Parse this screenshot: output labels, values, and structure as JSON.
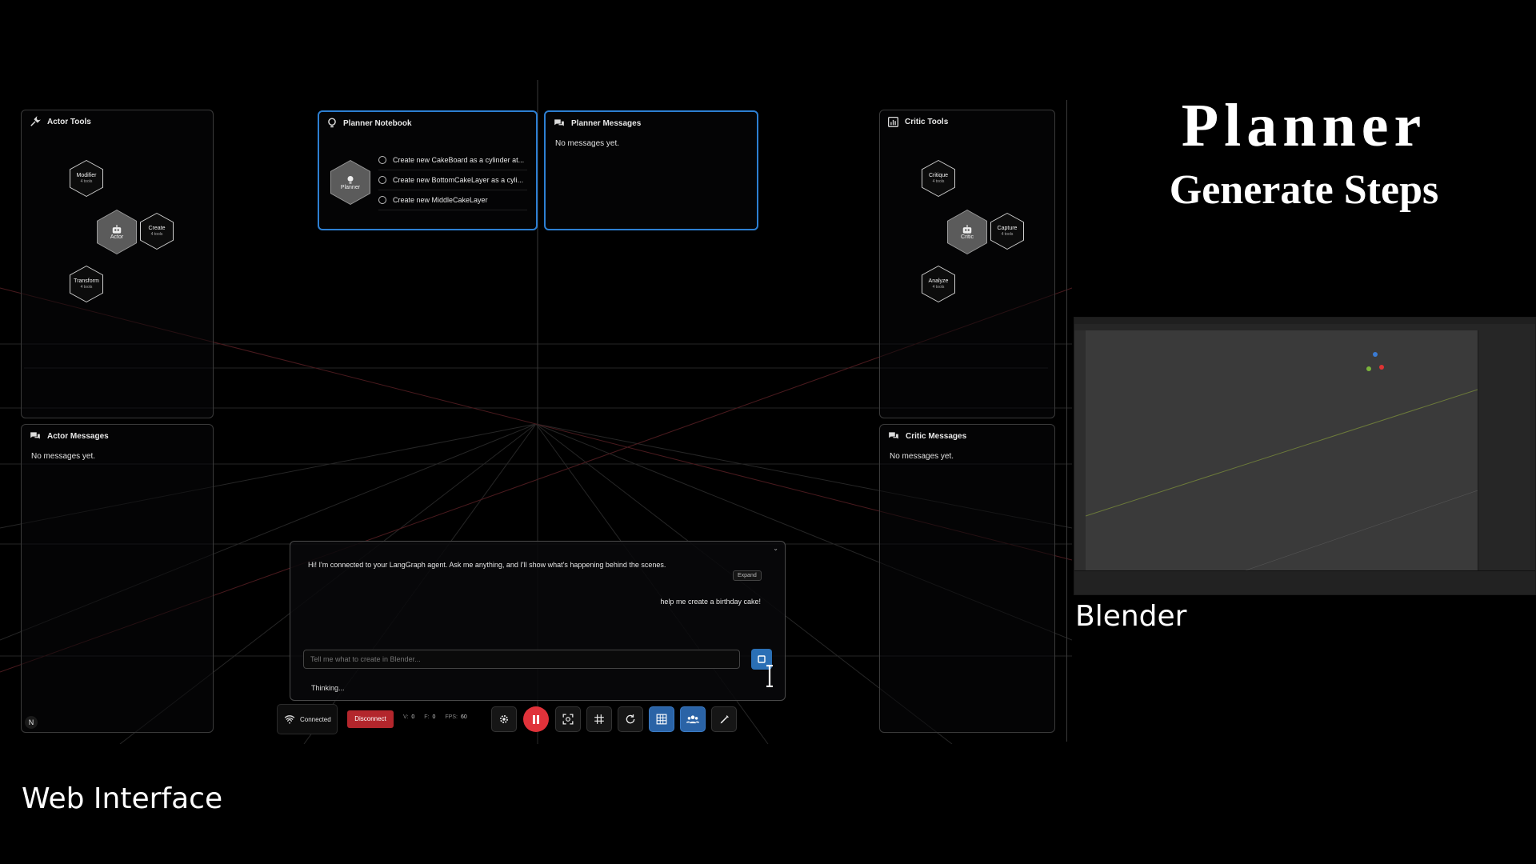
{
  "overlay": {
    "title": "Planner",
    "subtitle": "Generate Steps",
    "web_caption": "Web Interface",
    "blender_caption": "Blender"
  },
  "actor_tools": {
    "title": "Actor Tools",
    "center": "Actor",
    "nodes": [
      {
        "label": "Modifier",
        "sub": "4 tools"
      },
      {
        "label": "Create",
        "sub": "4 tools"
      },
      {
        "label": "Transform",
        "sub": "4 tools"
      }
    ]
  },
  "actor_messages": {
    "title": "Actor Messages",
    "empty": "No messages yet."
  },
  "planner_notebook": {
    "title": "Planner Notebook",
    "center": "Planner",
    "items": [
      "Create new CakeBoard as a cylinder at...",
      "Create new BottomCakeLayer as a cyli...",
      "Create new MiddleCakeLayer"
    ]
  },
  "planner_messages": {
    "title": "Planner Messages",
    "empty": "No messages yet."
  },
  "critic_tools": {
    "title": "Critic Tools",
    "center": "Critic",
    "nodes": [
      {
        "label": "Critique",
        "sub": "4 tools"
      },
      {
        "label": "Capture",
        "sub": "4 tools"
      },
      {
        "label": "Analyze",
        "sub": "4 tools"
      }
    ]
  },
  "critic_messages": {
    "title": "Critic Messages",
    "empty": "No messages yet."
  },
  "chat": {
    "agent_message": "Hi! I'm connected to your LangGraph agent. Ask me anything, and I'll show what's happening behind the scenes.",
    "expand_label": "Expand",
    "user_message": "help me create a birthday cake!",
    "input_placeholder": "Tell me what to create in Blender...",
    "status": "Thinking..."
  },
  "toolbar": {
    "connected_label": "Connected",
    "disconnect_label": "Disconnect",
    "v_label": "V:",
    "v_value": "0",
    "f_label": "F:",
    "f_value": "0",
    "fps_label": "FPS:",
    "fps_value": "60"
  },
  "corner_badge": "N",
  "colors": {
    "accent_blue": "#2d7fd2",
    "disconnect_red": "#b3262c",
    "pause_red": "#e0323a",
    "text": "#e6e6e6"
  }
}
